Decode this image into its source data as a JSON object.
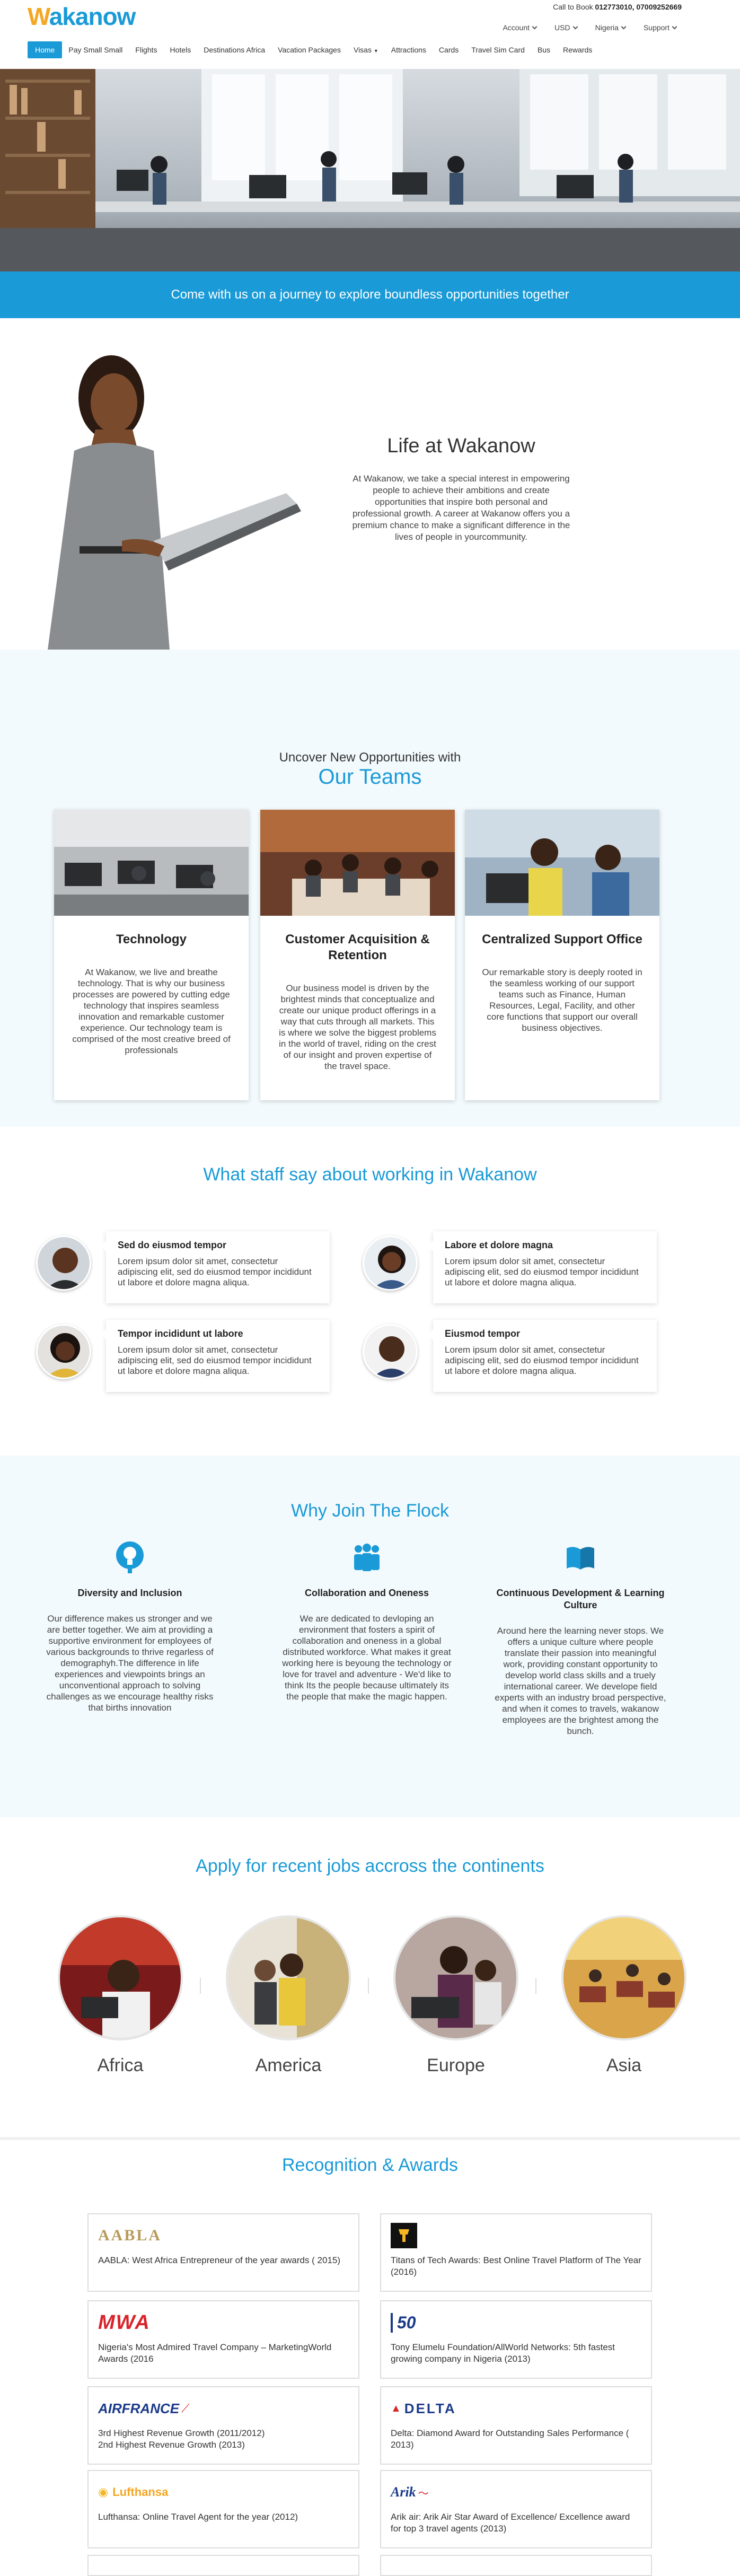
{
  "header": {
    "logo": "Wakanow",
    "book_label": "Call to Book",
    "book_phones": "012773010, 07009252669",
    "account_menu": [
      "Account",
      "USD",
      "Nigeria",
      "Support"
    ],
    "nav": [
      "Home",
      "Pay Small Small",
      "Flights",
      "Hotels",
      "Destinations Africa",
      "Vacation Packages",
      "Visas",
      "Attractions",
      "Cards",
      "Travel Sim Card",
      "Bus",
      "Rewards"
    ]
  },
  "banner": "Come with us on a journey to explore boundless opportunities together",
  "life": {
    "title": "Life at Wakanow",
    "text": "At Wakanow, we take a special interest in empowering people to achieve their ambitions and create opportunities that inspire both personal and professional growth. A career at Wakanow offers you a premium chance to make a significant difference in the lives of people in yourcommunity."
  },
  "teams": {
    "subtitle": "Uncover New Opportunities with",
    "title": "Our Teams",
    "cards": [
      {
        "title": "Technology",
        "text": "At Wakanow, we live and breathe technology. That is why our business processes are powered by cutting edge technology that inspires seamless innovation and remarkable customer experience. Our technology team is comprised of the most creative breed of professionals"
      },
      {
        "title": "Customer Acquisition & Retention",
        "text": "Our business model is driven by the brightest minds that conceptualize and create our unique product offerings in a way that cuts through all markets. This is where we solve the biggest problems in the world of travel, riding on the crest of our insight and proven expertise of the travel space."
      },
      {
        "title": "Centralized Support Office",
        "text": "Our remarkable story is deeply rooted in the seamless working of our support teams such as Finance, Human Resources, Legal, Facility, and other core functions that support our overall business objectives."
      }
    ]
  },
  "staff": {
    "title": "What staff say about working in Wakanow",
    "items": [
      {
        "name": "Sed do eiusmod tempor",
        "text": "Lorem ipsum dolor sit amet, consectetur adipiscing elit, sed do eiusmod tempor incididunt ut labore et dolore magna aliqua."
      },
      {
        "name": "Labore et dolore magna",
        "text": "Lorem ipsum dolor sit amet, consectetur adipiscing elit, sed do eiusmod tempor incididunt ut labore et dolore magna aliqua."
      },
      {
        "name": "Tempor incididunt ut labore",
        "text": "Lorem ipsum dolor sit amet, consectetur adipiscing elit, sed do eiusmod tempor incididunt ut labore et dolore magna aliqua."
      },
      {
        "name": "Eiusmod tempor",
        "text": "Lorem ipsum dolor sit amet, consectetur adipiscing elit, sed do eiusmod tempor incididunt ut labore et dolore magna aliqua."
      }
    ]
  },
  "flock": {
    "title": "Why Join The Flock",
    "cols": [
      {
        "icon": "lightbulb-icon",
        "title": "Diversity and Inclusion",
        "text": "Our difference makes us stronger and we are better together. We aim at providing a supportive environment for employees of various backgrounds to thrive regarless of demographyh.The difference in life experiences and viewpoints brings an unconventional approach to solving challenges as we encourage healthy risks that births innovation"
      },
      {
        "icon": "team-icon",
        "title": "Collaboration and Oneness",
        "text": "We are dedicated to devloping an environment that fosters a spirit of collaboration and oneness in a global distributed workforce. What makes it great working here is beyoung the technology or love for travel and adventure - We'd like to think Its the people because ultimately its the people that make the magic happen."
      },
      {
        "icon": "book-icon",
        "title": "Continuous Development & Learning Culture",
        "text": "Around here the learning never stops. We offers a unique culture where people translate their passion into meaningful work, providing constant opportunity to develop world class skills and a truely international career. We develope field experts with an industry broad perspective, and when it comes to travels, wakanow employees are the brightest among the bunch."
      }
    ]
  },
  "jobs": {
    "title": "Apply for recent jobs accross the continents",
    "continents": [
      "Africa",
      "America",
      "Europe",
      "Asia"
    ]
  },
  "awards": {
    "title": "Recognition & Awards",
    "items": [
      {
        "logo": "AABLA",
        "text": "AABLA: West Africa Entrepreneur of the year awards ( 2015)"
      },
      {
        "logo": "",
        "text": "Titans of Tech Awards: Best Online Travel Platform of The Year (2016)"
      },
      {
        "logo": "MWA",
        "text": "Nigeria's Most Admired Travel Company – MarketingWorld Awards   (2016"
      },
      {
        "logo": "50",
        "text": "Tony Elumelu Foundation/AllWorld Networks: 5th fastest growing company in Nigeria  (2013)"
      },
      {
        "logo": "AIRFRANCE",
        "text": "3rd Highest Revenue Growth          (2011/2012)\n2nd Highest Revenue Growth          (2013)"
      },
      {
        "logo": "DELTA",
        "text": "Delta: Diamond Award for Outstanding Sales Performance   ( 2013)"
      },
      {
        "logo": "Lufthansa",
        "text": "Lufthansa: Online  Travel Agent for the year (2012)"
      },
      {
        "logo": "Arik",
        "text": "Arik air: Arik Air Star Award of Excellence/ Excellence award for top 3 travel agents   (2013)"
      }
    ]
  },
  "colors": {
    "brand": "#1a9ad7",
    "logo_accent": "#f5a623",
    "section_bg": "#f3fafd"
  }
}
